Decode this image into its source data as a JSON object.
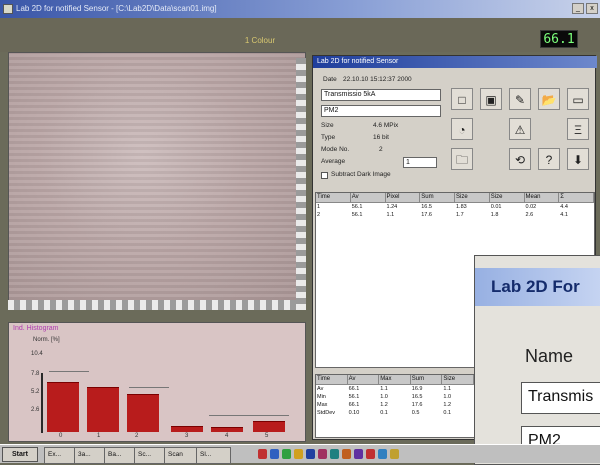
{
  "window": {
    "title": "Lab 2D for notified Sensor - [C:\\Lab2D\\Data\\scan01.img]",
    "minimize_label": "_",
    "close_label": "x"
  },
  "header": {
    "center_title": "1 Colour",
    "lcd_value": "66.1"
  },
  "histogram": {
    "title": "Ind. Histogram",
    "y_label": "Norm. [%]",
    "y_ticks": [
      "10.4",
      "7.8",
      "5.2",
      "2.6"
    ],
    "x_labels": [
      "0",
      "1",
      "2",
      "3",
      "4",
      "5"
    ]
  },
  "chart_data": {
    "type": "bar",
    "categories": [
      "0",
      "1",
      "2",
      "3",
      "4",
      "5"
    ],
    "values": [
      0.82,
      0.74,
      0.62,
      0.08,
      0.06,
      0.16
    ],
    "ylabel": "Norm. [%]"
  },
  "lab": {
    "title": "Lab 2D for notified Sensor",
    "date_label": "Date",
    "date_value": "22.10.10 15:12:37 2000",
    "name_value": "Transmissio 5kA",
    "sensor_value": "PM2",
    "size_label": "Size",
    "size_value": "4.6 MPix",
    "type_label": "Type",
    "type_value": "16 bit",
    "mode_label": "Mode No.",
    "mode_value": "2",
    "average_label": "Average",
    "average_value": "1",
    "checkbox_label": "Subtract Dark Image",
    "tools": [
      "□",
      "▣",
      "✎",
      "📂",
      "▭",
      "◔",
      "⚠",
      "Ξ",
      "🗀",
      "⟲",
      "?",
      "⬇"
    ],
    "grid1_headers": [
      "Time",
      "Av",
      "Pixel",
      "Sum",
      "Size",
      "Size",
      "Mean",
      "Σ"
    ],
    "grid1_rows": [
      [
        "1",
        "56.1",
        "1.24",
        "16.5",
        "1.83",
        "0.01",
        "0.02",
        "4.4"
      ],
      [
        "2",
        "56.1",
        "1.1",
        "17.6",
        "1.7",
        "1.8",
        "2.6",
        "4.1"
      ]
    ],
    "grid2_headers": [
      "Time",
      "Av",
      "Max",
      "Sum",
      "Size"
    ],
    "grid2_rows": [
      [
        "Av",
        "66.1",
        "1.1",
        "16.9",
        "1.1"
      ],
      [
        "Min",
        "56.1",
        "1.0",
        "16.5",
        "1.0"
      ],
      [
        "Max",
        "66.1",
        "1.2",
        "17.6",
        "1.2"
      ],
      [
        "StdDev",
        "0.10",
        "0.1",
        "0.5",
        "0.1"
      ]
    ]
  },
  "zoom": {
    "title": "Lab 2D For",
    "name_label": "Name",
    "name_value": "Transmis",
    "sensor_value": "PM2"
  },
  "taskbar": {
    "start_label": "Start",
    "tasks": [
      "Ex...",
      "3a...",
      "Ba...",
      "Sc...",
      "Scan",
      "Sl..."
    ]
  }
}
